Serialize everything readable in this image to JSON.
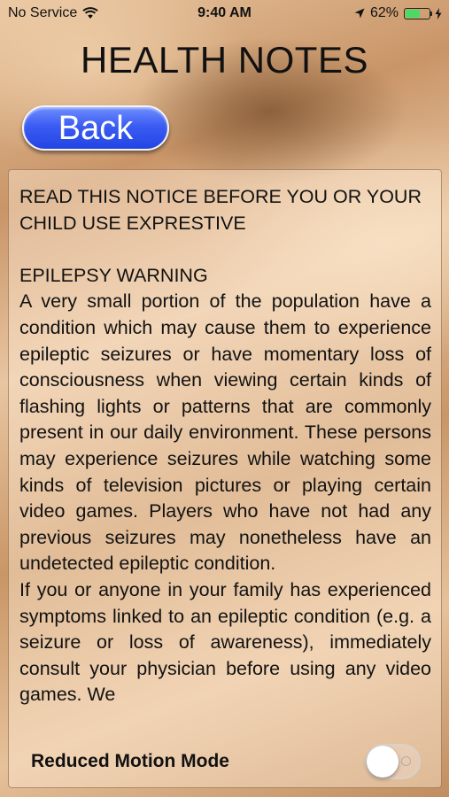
{
  "status_bar": {
    "carrier": "No Service",
    "time": "9:40 AM",
    "battery_percent": "62%",
    "battery_level": 0.62,
    "icons": [
      "wifi-icon",
      "location-arrow-icon",
      "battery-icon",
      "charging-bolt-icon"
    ]
  },
  "header": {
    "title": "HEALTH NOTES",
    "back_label": "Back"
  },
  "notice": {
    "heading": "READ THIS NOTICE BEFORE YOU OR YOUR CHILD USE EXPRESTIVE",
    "warning_title": "EPILEPSY WARNING",
    "paragraph_1": "A very small portion of the population have a condition which may cause them to experience epileptic seizures or have momentary loss of consciousness when viewing certain kinds of flashing lights or patterns that are commonly present in our daily environment. These persons may experience seizures while watching some kinds of television pictures or playing certain video games. Players who have not had any previous seizures may nonetheless have an undetected epileptic condition.",
    "paragraph_2": "If you or anyone in your family has experienced symptoms linked to an epileptic condition (e.g. a seizure or loss of awareness), immediately consult your physician before using any video games. We"
  },
  "settings": {
    "reduced_motion_label": "Reduced Motion Mode",
    "reduced_motion_on": false
  },
  "colors": {
    "back_button": "#3b5cf3",
    "battery_fill": "#4cd964"
  }
}
